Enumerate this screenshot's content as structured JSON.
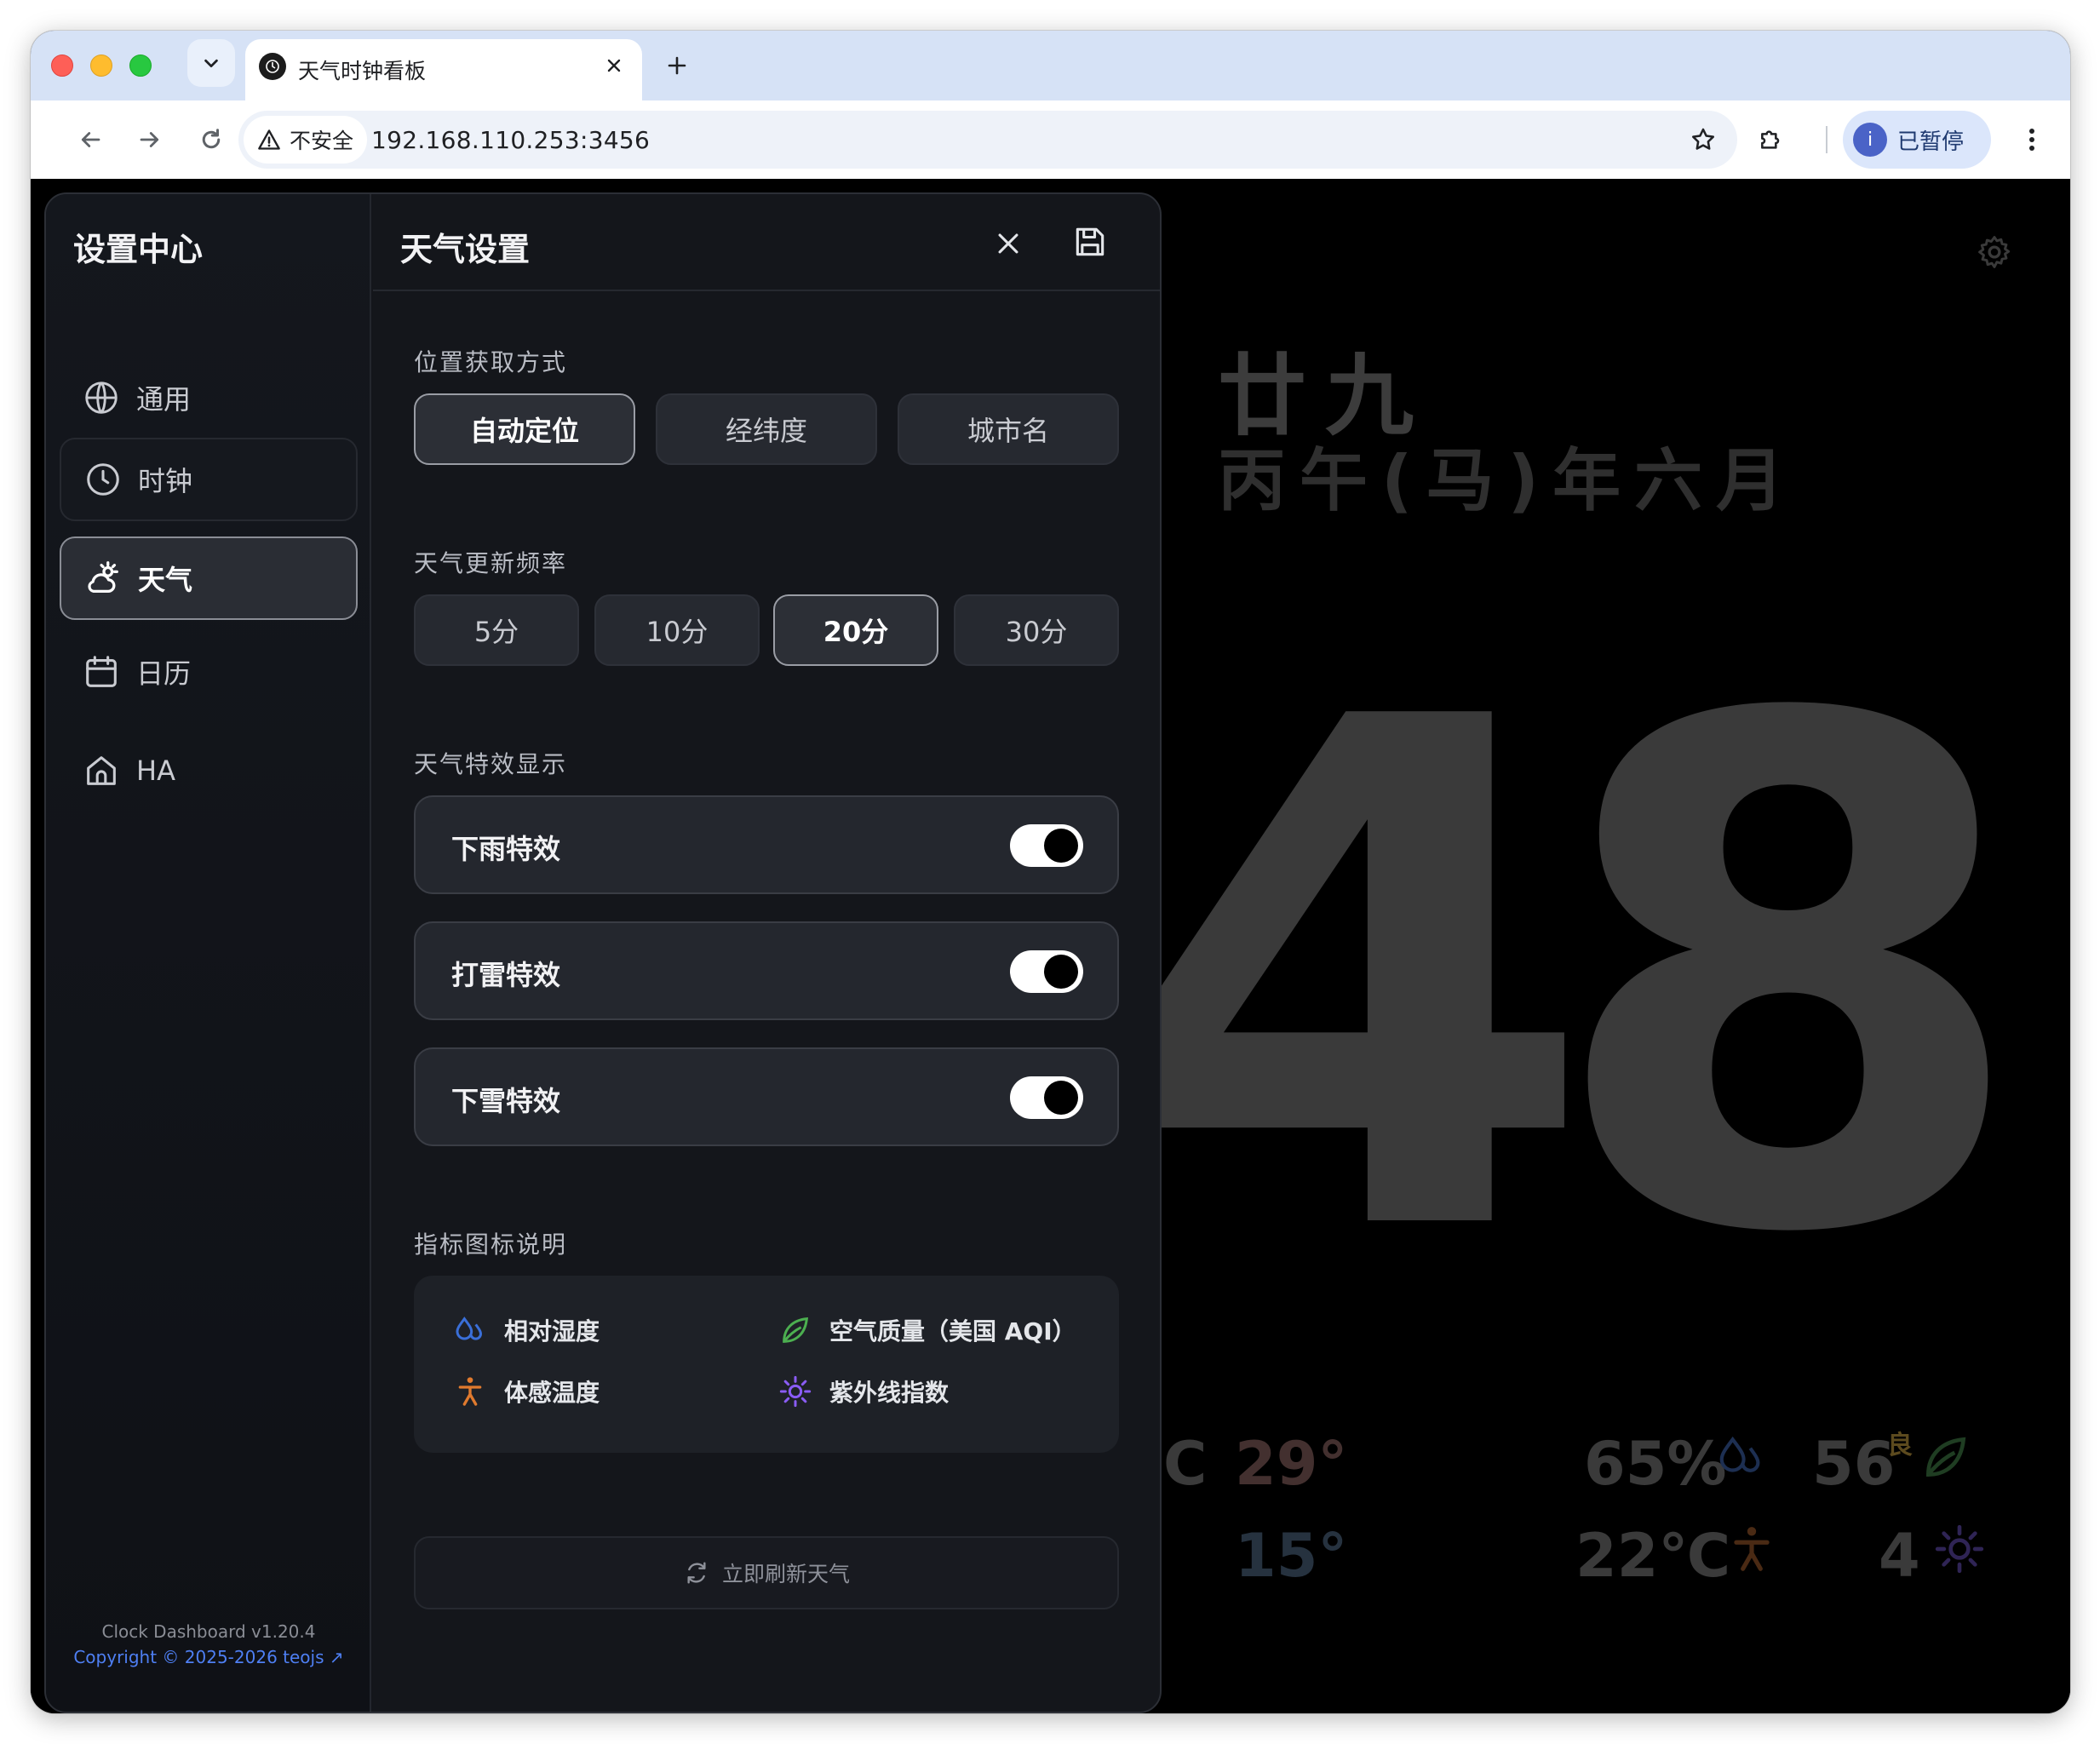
{
  "browser": {
    "tab_title": "天气时钟看板",
    "security_label": "不安全",
    "url": "192.168.110.253:3456",
    "profile_initial": "i",
    "profile_label": "已暂停"
  },
  "background": {
    "lunar_day": "廿九",
    "lunar_month": "丙午(马)年六月",
    "time_digits": "48",
    "temp_partial": "C",
    "temp_high": "29°",
    "temp_low": "15°",
    "humidity": "65%",
    "aqi": "56",
    "aqi_level": "良",
    "feels_like": "22℃",
    "uv": "4"
  },
  "sidebar": {
    "title": "设置中心",
    "items": [
      {
        "label": "通用",
        "icon": "globe-icon"
      },
      {
        "label": "时钟",
        "icon": "clock-icon"
      },
      {
        "label": "天气",
        "icon": "weather-icon"
      },
      {
        "label": "日历",
        "icon": "calendar-icon"
      },
      {
        "label": "HA",
        "icon": "home-icon"
      }
    ],
    "active_index": 2,
    "footer_version": "Clock Dashboard v1.20.4",
    "footer_copyright": "Copyright © 2025-2026 teojs ↗"
  },
  "weather_settings": {
    "title": "天气设置",
    "location": {
      "label": "位置获取方式",
      "options": [
        "自动定位",
        "经纬度",
        "城市名"
      ],
      "selected": "自动定位"
    },
    "update_frequency": {
      "label": "天气更新频率",
      "options": [
        "5分",
        "10分",
        "20分",
        "30分"
      ],
      "selected": "20分"
    },
    "effects": {
      "label": "天气特效显示",
      "items": [
        {
          "label": "下雨特效",
          "enabled": true
        },
        {
          "label": "打雷特效",
          "enabled": true
        },
        {
          "label": "下雪特效",
          "enabled": true
        }
      ]
    },
    "legend": {
      "label": "指标图标说明",
      "items": [
        {
          "label": "相对湿度",
          "icon": "humidity-icon"
        },
        {
          "label": "空气质量（美国 AQI）",
          "icon": "leaf-icon"
        },
        {
          "label": "体感温度",
          "icon": "person-icon"
        },
        {
          "label": "紫外线指数",
          "icon": "sun-icon"
        }
      ]
    },
    "refresh_label": "立即刷新天气"
  },
  "colors": {
    "humidity": "#3a6fd8",
    "aqi": "#4caf50",
    "feels": "#e07a2e",
    "uv": "#8a5cf6",
    "aqi_level": "#d2a526"
  }
}
